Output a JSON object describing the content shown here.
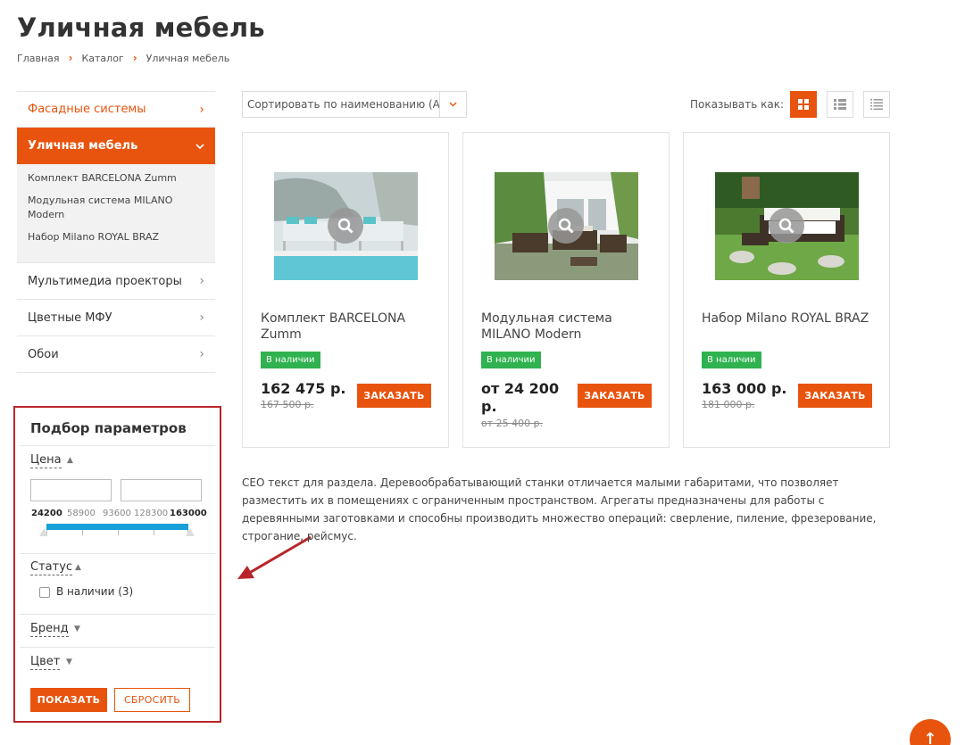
{
  "page": {
    "title": "Уличная мебель"
  },
  "breadcrumb": [
    "Главная",
    "Каталог",
    "Уличная мебель"
  ],
  "sidebar": {
    "items": [
      {
        "label": "Фасадные системы"
      },
      {
        "label": "Уличная мебель"
      },
      {
        "label": "Мультимедиа проекторы"
      },
      {
        "label": "Цветные МФУ"
      },
      {
        "label": "Обои"
      }
    ],
    "subitems": [
      "Комплект BARCELONA Zumm",
      "Модульная система MILANO Modern",
      "Набор Milano ROYAL BRAZ"
    ]
  },
  "filter": {
    "title": "Подбор параметров",
    "price_label": "Цена",
    "price_ticks": [
      "24200",
      "58900",
      "93600",
      "128300",
      "163000"
    ],
    "status_label": "Статус",
    "in_stock_label": "В наличии (3)",
    "brand_label": "Бренд",
    "color_label": "Цвет",
    "show_button": "ПОКАЗАТЬ",
    "reset_button": "СБРОСИТЬ"
  },
  "toolbar": {
    "sort_value": "Сортировать по наименованию (А",
    "view_label": "Показывать как:"
  },
  "products": [
    {
      "name": "Комплект BARCELONA Zumm",
      "badge": "В наличии",
      "price": "162 475 р.",
      "old_price": "167 500 р.",
      "order": "ЗАКАЗАТЬ"
    },
    {
      "name": "Модульная система MILANO Modern",
      "badge": "В наличии",
      "price": "от 24 200 р.",
      "old_price": "от 25 400 р.",
      "order": "ЗАКАЗАТЬ"
    },
    {
      "name": "Набор Milano ROYAL BRAZ",
      "badge": "В наличии",
      "price": "163 000 р.",
      "old_price": "181 000 р.",
      "order": "ЗАКАЗАТЬ"
    }
  ],
  "seo_text": "СЕО текст для раздела. Деревообрабатывающий станки отличается малыми габаритами, что позволяет разместить их в помещениях с ограниченным пространством. Агрегаты предназначены для работы с деревянными заготовками и способны производить множество операций: сверление, пиление, фрезерование, строгание, рейсмус.",
  "colors": {
    "accent": "#e8540e",
    "badge": "#2fb24f",
    "highlight_border": "#b9252a",
    "slider": "#19a0d8"
  }
}
